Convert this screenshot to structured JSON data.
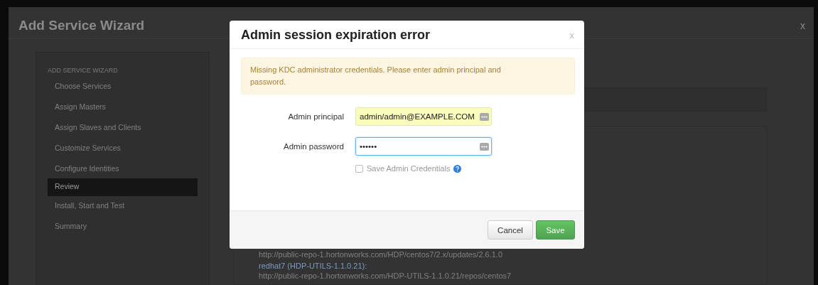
{
  "wizard": {
    "title": "Add Service Wizard",
    "close": "x"
  },
  "sidebar": {
    "heading": "ADD SERVICE WIZARD",
    "items": [
      {
        "label": "Choose Services",
        "selected": false
      },
      {
        "label": "Assign Masters",
        "selected": false
      },
      {
        "label": "Assign Slaves and Clients",
        "selected": false
      },
      {
        "label": "Customize Services",
        "selected": false
      },
      {
        "label": "Configure Identities",
        "selected": false
      },
      {
        "label": "Review",
        "selected": true
      },
      {
        "label": "Install, Start and Test",
        "selected": false
      },
      {
        "label": "Summary",
        "selected": false
      }
    ]
  },
  "content": {
    "lines": [
      {
        "kind": "url",
        "text": "http://public-repo-1.hortonworks.com/HDP/centos7/2.x/updates/2.6.1.0"
      },
      {
        "kind": "repo",
        "text": "redhat7 (HDP-UTILS-1.1.0.21):"
      },
      {
        "kind": "url",
        "text": "http://public-repo-1.hortonworks.com/HDP-UTILS-1.1.0.21/repos/centos7"
      }
    ]
  },
  "dialog": {
    "title": "Admin session expiration error",
    "close": "x",
    "alert": "Missing KDC administrator credentials. Please enter admin principal and password.",
    "fields": [
      {
        "label": "Admin principal",
        "value": "admin/admin@EXAMPLE.COM",
        "autofilled": true,
        "focused": false
      },
      {
        "label": "Admin password",
        "value": "••••••",
        "autofilled": false,
        "focused": true
      }
    ],
    "remember": {
      "label": "Save Admin Credentials",
      "checked": false
    },
    "buttons": [
      {
        "label": "Cancel",
        "kind": "default"
      },
      {
        "label": "Save",
        "kind": "primary"
      }
    ]
  }
}
